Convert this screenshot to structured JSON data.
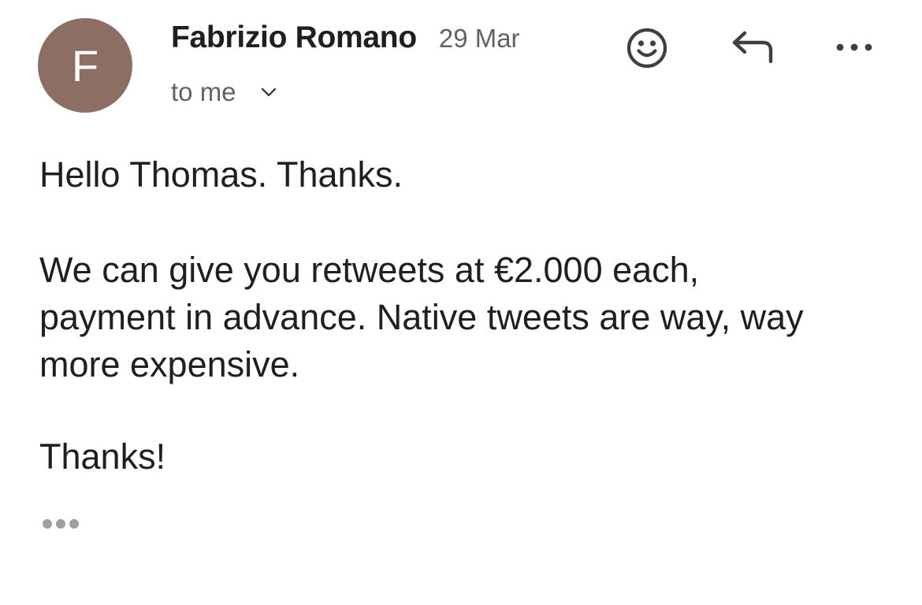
{
  "sender": {
    "avatar_letter": "F",
    "avatar_color": "#8d6e63",
    "name": "Fabrizio Romano",
    "date": "29 Mar"
  },
  "recipient": {
    "label": "to me",
    "icon": "chevron-down-icon"
  },
  "actions": {
    "emoji_icon": "smiley-icon",
    "reply_icon": "reply-arrow-icon",
    "more_icon": "more-horizontal-icon"
  },
  "message": {
    "paragraphs": [
      "Hello Thomas. Thanks.",
      "We can give you retweets at €2.000 each,\npayment in advance. Native tweets are way, way\nmore expensive.",
      "Thanks!"
    ],
    "trimmed_content_icon": "ellipsis-icon"
  },
  "colors": {
    "text_primary": "#1f1f1f",
    "text_secondary": "#5f6368",
    "icon": "#3c4043",
    "ellipsis": "#9aa0a6"
  }
}
